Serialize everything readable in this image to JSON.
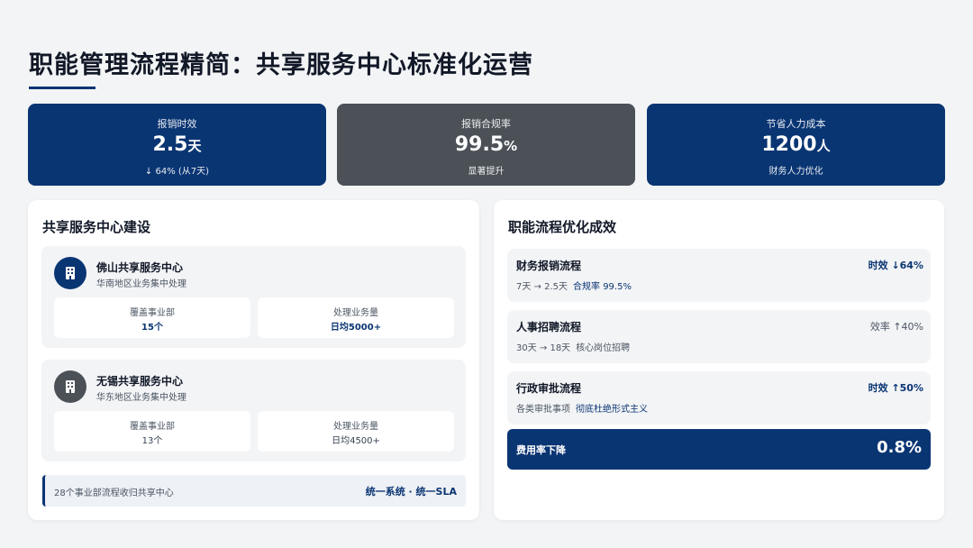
{
  "header": {
    "title": "职能管理流程精简：共享服务中心标准化运营"
  },
  "kpis": [
    {
      "label": "报销时效",
      "value": "2.5",
      "unit": "天",
      "sub": "↓ 64% (从7天)"
    },
    {
      "label": "报销合规率",
      "value": "99.5",
      "unit": "%",
      "sub": "显著提升"
    },
    {
      "label": "节省人力成本",
      "value": "1200",
      "unit": "人",
      "sub": "财务人力优化"
    }
  ],
  "left_panel": {
    "title": "共享服务中心建设",
    "centers": [
      {
        "name": "佛山共享服务中心",
        "desc": "华南地区业务集中处理",
        "stat1_label": "覆盖事业部",
        "stat1_value": "15个",
        "stat2_label": "处理业务量",
        "stat2_value": "日均5000+"
      },
      {
        "name": "无锡共享服务中心",
        "desc": "华东地区业务集中处理",
        "stat1_label": "覆盖事业部",
        "stat1_value": "13个",
        "stat2_label": "处理业务量",
        "stat2_value": "日均4500+"
      }
    ],
    "bottom_text": "28个事业部流程收归共享中心",
    "bottom_link": "统一系统 · 统一SLA"
  },
  "right_panel": {
    "title": "职能流程优化成效",
    "flows": [
      {
        "name": "财务报销流程",
        "metric": "时效 ↓64%",
        "desc": "7天 → 2.5天",
        "desc_hl": "合规率 99.5%"
      },
      {
        "name": "人事招聘流程",
        "metric": "效率 ↑40%",
        "desc": "30天 → 18天",
        "desc_hl": "核心岗位招聘"
      },
      {
        "name": "行政审批流程",
        "metric": "时效 ↑50%",
        "desc": "各类审批事项",
        "desc_hl": "彻底杜绝形式主义"
      }
    ],
    "cost_label": "费用率下降",
    "cost_value": "0.8%"
  },
  "colors": {
    "navy": "#0a3573",
    "slate": "#4b5157",
    "background": "#f3f4f6"
  },
  "icons": {
    "center_icon": "building-icon"
  }
}
